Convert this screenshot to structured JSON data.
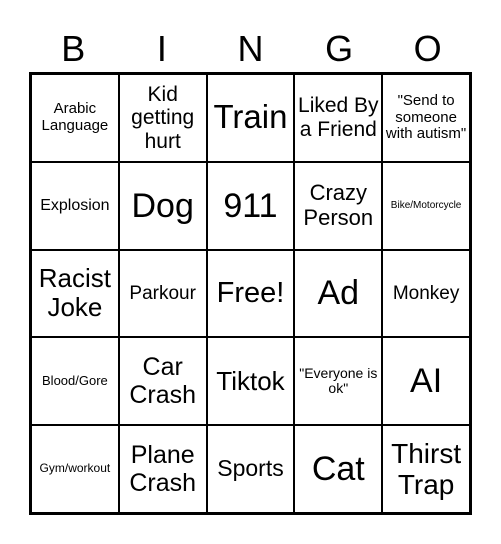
{
  "header": {
    "letters": [
      "B",
      "I",
      "N",
      "G",
      "O"
    ]
  },
  "cells": [
    {
      "text": "Arabic Language",
      "size": 15
    },
    {
      "text": "Kid getting hurt",
      "size": 21
    },
    {
      "text": "Train",
      "size": 33
    },
    {
      "text": "Liked By a Friend",
      "size": 21
    },
    {
      "text": "\"Send to someone with autism\"",
      "size": 15
    },
    {
      "text": "Explosion",
      "size": 16
    },
    {
      "text": "Dog",
      "size": 34
    },
    {
      "text": "911",
      "size": 34
    },
    {
      "text": "Crazy Person",
      "size": 22
    },
    {
      "text": "Bike/Motorcycle",
      "size": 10
    },
    {
      "text": "Racist Joke",
      "size": 26
    },
    {
      "text": "Parkour",
      "size": 19
    },
    {
      "text": "Free!",
      "size": 29
    },
    {
      "text": "Ad",
      "size": 34
    },
    {
      "text": "Monkey",
      "size": 19
    },
    {
      "text": "Blood/Gore",
      "size": 13
    },
    {
      "text": "Car Crash",
      "size": 25
    },
    {
      "text": "Tiktok",
      "size": 26
    },
    {
      "text": "\"Everyone is ok\"",
      "size": 14
    },
    {
      "text": "AI",
      "size": 34
    },
    {
      "text": "Gym/workout",
      "size": 12
    },
    {
      "text": "Plane Crash",
      "size": 25
    },
    {
      "text": "Sports",
      "size": 23
    },
    {
      "text": "Cat",
      "size": 34
    },
    {
      "text": "Thirst Trap",
      "size": 28
    }
  ]
}
